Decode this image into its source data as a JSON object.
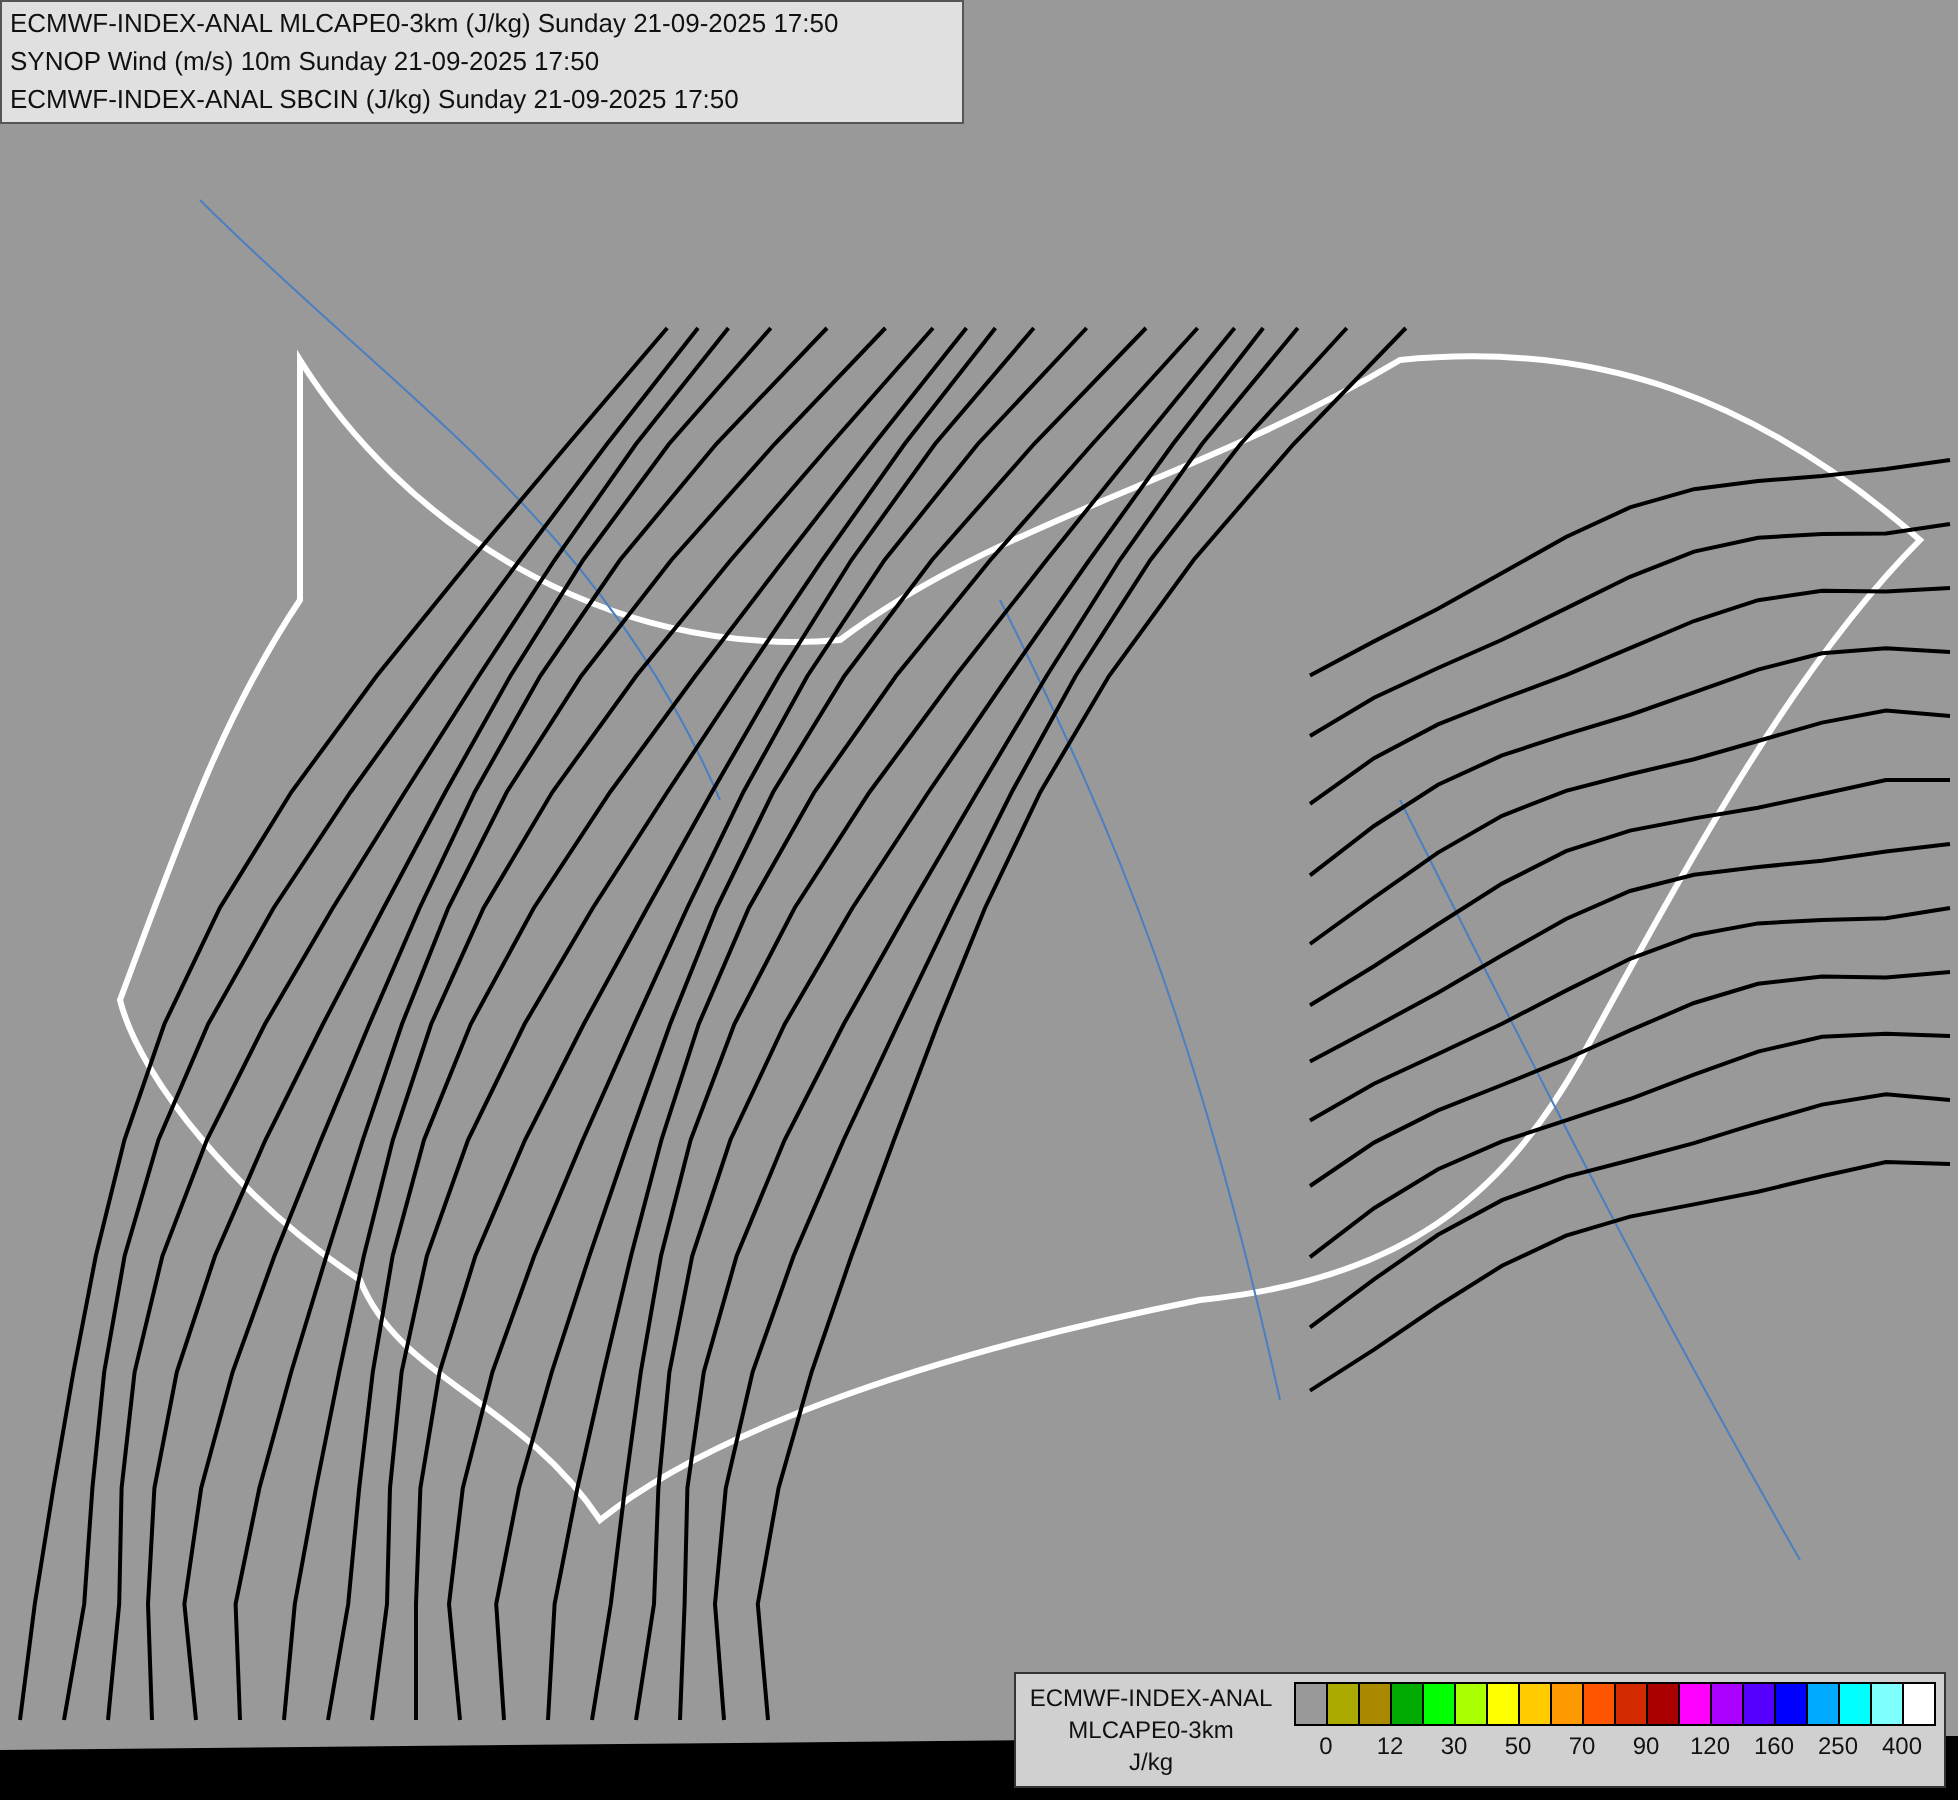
{
  "header": {
    "lines": [
      "ECMWF-INDEX-ANAL MLCAPE0-3km (J/kg) Sunday 21-09-2025 17:50",
      "SYNOP Wind (m/s) 10m Sunday 21-09-2025 17:50",
      "ECMWF-INDEX-ANAL SBCIN (J/kg) Sunday 21-09-2025 17:50"
    ]
  },
  "legend": {
    "title": [
      "ECMWF-INDEX-ANAL",
      "MLCAPE0-3km",
      "J/kg"
    ],
    "swatches": [
      {
        "color": "#999999"
      },
      {
        "color": "#aaaa00"
      },
      {
        "color": "#aa8800"
      },
      {
        "color": "#00aa00"
      },
      {
        "color": "#00ff00"
      },
      {
        "color": "#aaff00"
      },
      {
        "color": "#ffff00"
      },
      {
        "color": "#ffcc00"
      },
      {
        "color": "#ff9900"
      },
      {
        "color": "#ff5500"
      },
      {
        "color": "#d42a00"
      },
      {
        "color": "#aa0000"
      },
      {
        "color": "#ff00ff"
      },
      {
        "color": "#aa00ff"
      },
      {
        "color": "#5500ff"
      },
      {
        "color": "#0000ff"
      },
      {
        "color": "#00aaff"
      },
      {
        "color": "#00ffff"
      },
      {
        "color": "#80ffff"
      },
      {
        "color": "#ffffff"
      }
    ],
    "ticks": [
      "0",
      "12",
      "30",
      "50",
      "70",
      "90",
      "120",
      "160",
      "250",
      "400"
    ]
  }
}
